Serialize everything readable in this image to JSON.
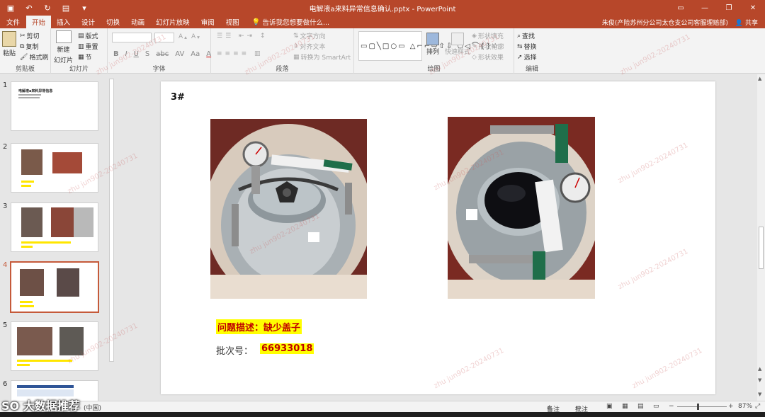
{
  "window": {
    "title": "电解液a来料异常信息确认.pptx - PowerPoint",
    "qat_icons": [
      "save-icon",
      "undo-icon",
      "redo-icon",
      "start-from-beginning-icon",
      "customize-qat-icon"
    ],
    "controls": [
      "ribbon-display-icon",
      "minimize-icon",
      "restore-icon",
      "close-icon"
    ]
  },
  "tabs": {
    "file": "文件",
    "items": [
      "开始",
      "插入",
      "设计",
      "切换",
      "动画",
      "幻灯片放映",
      "审阅",
      "视图"
    ],
    "active": "开始",
    "tell_me": "告诉我您想要做什么...",
    "user": "朱俊(产险苏州分公司太仓支公司客服理赔部)",
    "share": "共享"
  },
  "ribbon": {
    "clipboard": {
      "label": "剪贴板",
      "paste": "粘贴",
      "cut": "剪切",
      "copy": "复制",
      "format_painter": "格式刷"
    },
    "slides": {
      "label": "幻灯片",
      "new_slide": "新建",
      "new_slide_2": "幻灯片",
      "layout": "版式",
      "reset": "重置",
      "section": "节"
    },
    "font": {
      "label": "字体",
      "bold": "B",
      "italic": "I",
      "underline": "U",
      "strike": "S",
      "shadow": "abc",
      "spacing": "AV",
      "case": "Aa",
      "color": "A"
    },
    "paragraph": {
      "label": "段落",
      "text_direction": "文字方向",
      "align_text": "对齐文本",
      "smartart": "转换为 SmartArt"
    },
    "drawing": {
      "label": "绘图",
      "arrange": "排列",
      "quick_styles": "快速样式",
      "shape_fill": "形状填充",
      "shape_outline": "形状轮廓",
      "shape_effects": "形状效果"
    },
    "editing": {
      "label": "编辑",
      "find": "查找",
      "replace": "替换",
      "select": "选择"
    }
  },
  "thumbnails": [
    {
      "num": "1",
      "title": "电解液a来料异常信息"
    },
    {
      "num": "2"
    },
    {
      "num": "3"
    },
    {
      "num": "4",
      "selected": true
    },
    {
      "num": "5"
    },
    {
      "num": "6"
    }
  ],
  "slide": {
    "number_label": "3#",
    "issue": "问题描述：缺少盖子",
    "batch_label": "批次号：",
    "batch_value": "66933018"
  },
  "statusbar": {
    "language": "(中国)",
    "notes": "备注",
    "comments": "批注",
    "zoom": "87%"
  },
  "watermark": "zhu jun902-20240731",
  "corner_logo": "SO 大数据推荐",
  "colors": {
    "accent": "#b7472a",
    "highlight": "#ffff00",
    "alert_text": "#c00000"
  }
}
